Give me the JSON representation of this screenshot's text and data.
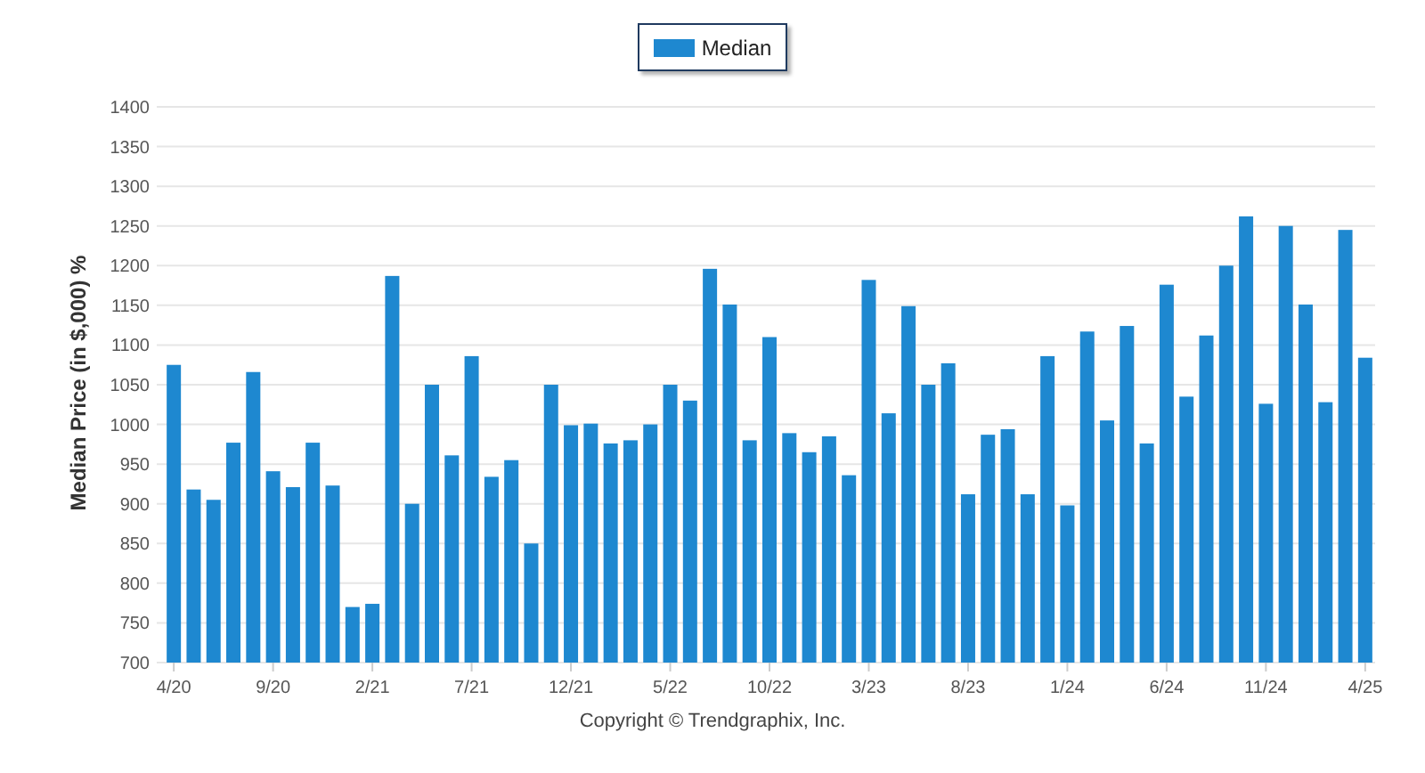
{
  "chart_data": {
    "type": "bar",
    "ylabel": "Median Price (in $,000) %",
    "grid": true,
    "categories": [
      "4/20",
      null,
      null,
      null,
      null,
      "9/20",
      null,
      null,
      null,
      null,
      "2/21",
      null,
      null,
      null,
      null,
      "7/21",
      null,
      null,
      null,
      null,
      "12/21",
      null,
      null,
      null,
      null,
      "5/22",
      null,
      null,
      null,
      null,
      "10/22",
      null,
      null,
      null,
      null,
      "3/23",
      null,
      null,
      null,
      null,
      "8/23",
      null,
      null,
      null,
      null,
      "1/24",
      null,
      null,
      null,
      null,
      "6/24",
      null,
      null,
      null,
      null,
      "11/24",
      null,
      null,
      null,
      null,
      "4/25"
    ],
    "series": [
      {
        "name": "Median",
        "color": "#1e88d0",
        "values": [
          1075,
          918,
          905,
          977,
          1066,
          941,
          921,
          977,
          923,
          770,
          774,
          1187,
          900,
          1050,
          961,
          1086,
          934,
          955,
          850,
          1050,
          999,
          1001,
          976,
          980,
          1000,
          1050,
          1030,
          1196,
          1151,
          980,
          1110,
          989,
          965,
          985,
          936,
          1182,
          1014,
          1149,
          1050,
          1077,
          912,
          987,
          994,
          912,
          1086,
          898,
          1117,
          1005,
          1124,
          976,
          1176,
          1035,
          1112,
          1200,
          1262,
          1026,
          1250,
          1151,
          1028,
          1245,
          1084
        ]
      }
    ],
    "ylim": [
      700,
      1400
    ],
    "yticks": [
      700,
      750,
      800,
      850,
      900,
      950,
      1000,
      1050,
      1100,
      1150,
      1200,
      1250,
      1300,
      1350,
      1400
    ]
  },
  "copyright": "Copyright © Trendgraphix, Inc."
}
